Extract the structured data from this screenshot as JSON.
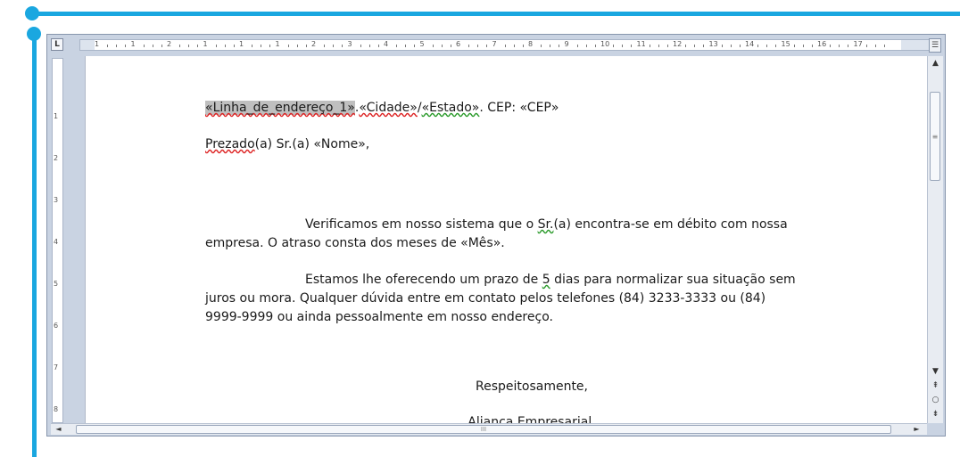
{
  "theme": {
    "accent": "#1aa7e0"
  },
  "ruler": {
    "corner_label": "L",
    "h_numbers": [
      "1",
      "1",
      "2",
      "1",
      "1",
      "1",
      "2",
      "3",
      "4",
      "5",
      "6",
      "7",
      "8",
      "9",
      "10",
      "11",
      "12",
      "13",
      "14",
      "15",
      "16",
      "17"
    ],
    "v_numbers": [
      "1",
      "2",
      "3",
      "4",
      "5",
      "6",
      "7",
      "8"
    ]
  },
  "document": {
    "address_line": {
      "field_address": "«Linha_de_endereço_1»",
      "sep1": ".",
      "field_city": "«Cidade»",
      "sep2": "/",
      "field_state": "«Estado»",
      "rest": ". CEP: «CEP»"
    },
    "greeting": {
      "word": "Prezado",
      "rest": "(a) Sr.(a) «Nome»,"
    },
    "para1": {
      "line1_a": "Verificamos em nosso sistema que o ",
      "line1_b": "Sr.",
      "line1_c": "(a) encontra-se em débito com nossa",
      "line2": "empresa. O atraso consta dos meses de «Mês»."
    },
    "para2": {
      "line1_a": "Estamos lhe oferecendo um prazo de ",
      "line1_b": "5",
      "line1_c": " dias para normalizar sua situação sem",
      "line2": "juros ou mora. Qualquer dúvida entre em contato pelos telefones (84) 3233-3333 ou (84)",
      "line3": "9999-9999 ou ainda pessoalmente em nosso endereço."
    },
    "closing": "Respeitosamente,",
    "signature": "Aliança Empresarial."
  },
  "scrollbar": {
    "up_icon": "▲",
    "down_icon": "▼",
    "prev_page_icon": "⇞",
    "browse_object_icon": "○",
    "next_page_icon": "⇟",
    "left_icon": "◄",
    "right_icon": "►",
    "thumb_grip": "≡",
    "h_thumb_grip": "III"
  }
}
